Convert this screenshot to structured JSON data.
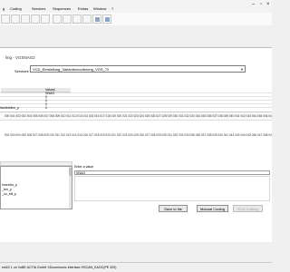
{
  "menubar": {
    "items": [
      "g",
      "Coding",
      "Services",
      "Sequences",
      "Extras",
      "Window",
      "?"
    ]
  },
  "window": {
    "title": "ling - VGSNAG2"
  },
  "services": {
    "label": "Services:",
    "value": "VCD_Einstellung_Variantencodierung_VGS_72"
  },
  "table": {
    "header": "Values",
    "values": [
      "SNAG",
      "0",
      "0",
      "0",
      "0",
      "0"
    ],
    "row_labels": [
      "",
      "",
      "",
      "",
      "",
      "itaufstellen_p"
    ]
  },
  "hex_rows": {
    "row1": "000 001 002 003 004 005 006 007 008 009 010 011 012 013 014 015 016 017 018 019 020 021 022 023 024 025 026 027 028 029 030 031 032 033 034 035 036 037 038 039 040 041 042 043 044 045 046 047 048 049 050 051",
    "row2": "002 003 004 005 006 007 008 009 010 011 012 013 014 015 016 017 018 019 020 021 022 023 024 025 026 027 028 029 030 031 032 033 034 035 036 037 038 039 040 041 042 043 044 045 046 047 048 049 050"
  },
  "left_list": {
    "items": [
      "",
      "",
      "",
      "innenfor_p",
      "_fen_p",
      "_vo_stil_p"
    ]
  },
  "enter_value": {
    "label": "Enter a value",
    "value": "SNAG"
  },
  "buttons": {
    "save": "Save to file",
    "manual": "Manual Coding",
    "ecu": "ECU Coding"
  },
  "status": {
    "text": "enAS 1 on VoBE ACTIA GmbH XDcommunic interface HSCAN_KAOC(PE 320)"
  }
}
